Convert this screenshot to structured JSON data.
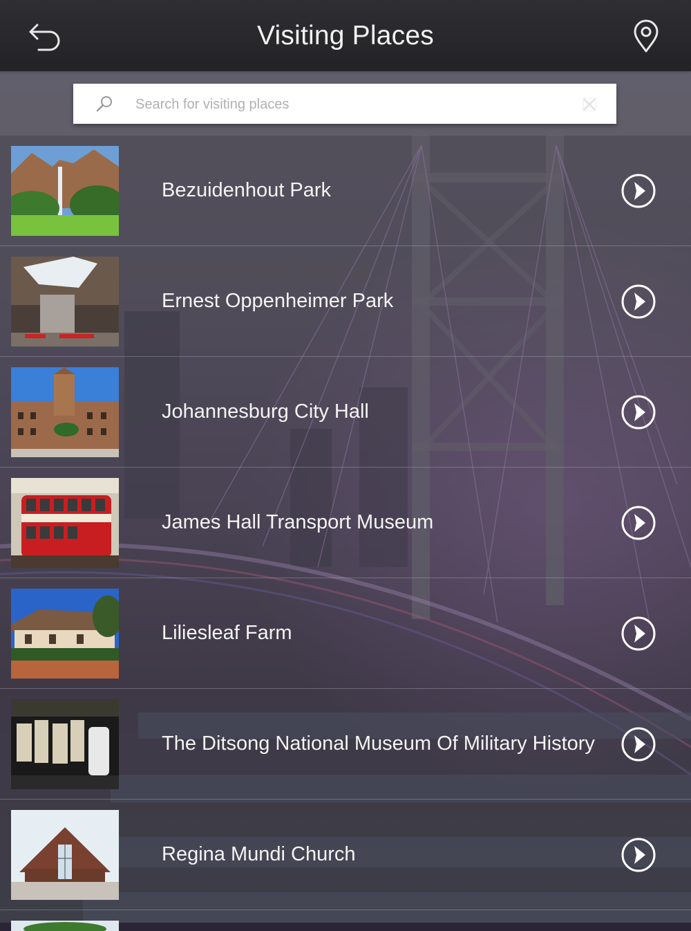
{
  "header": {
    "title": "Visiting Places",
    "back_icon": "back-arrow-icon",
    "map_icon": "map-pin-icon"
  },
  "search": {
    "placeholder": "Search for visiting places",
    "value": "",
    "search_icon": "search-icon",
    "clear_icon": "clear-icon"
  },
  "places": [
    {
      "name": "Bezuidenhout Park",
      "thumb": "waterfall-park"
    },
    {
      "name": "Ernest Oppenheimer Park",
      "thumb": "sculpture-park"
    },
    {
      "name": "Johannesburg City Hall",
      "thumb": "city-hall"
    },
    {
      "name": "James Hall Transport Museum",
      "thumb": "red-tram"
    },
    {
      "name": "Liliesleaf Farm",
      "thumb": "farmhouse"
    },
    {
      "name": "The Ditsong National Museum Of Military History",
      "thumb": "museum-exhibit"
    },
    {
      "name": "Regina Mundi Church",
      "thumb": "church"
    }
  ],
  "colors": {
    "header_bg": "#2a2a2d",
    "text": "#f4f4f4",
    "search_bg": "#ffffff",
    "placeholder": "#b0b0b0"
  }
}
